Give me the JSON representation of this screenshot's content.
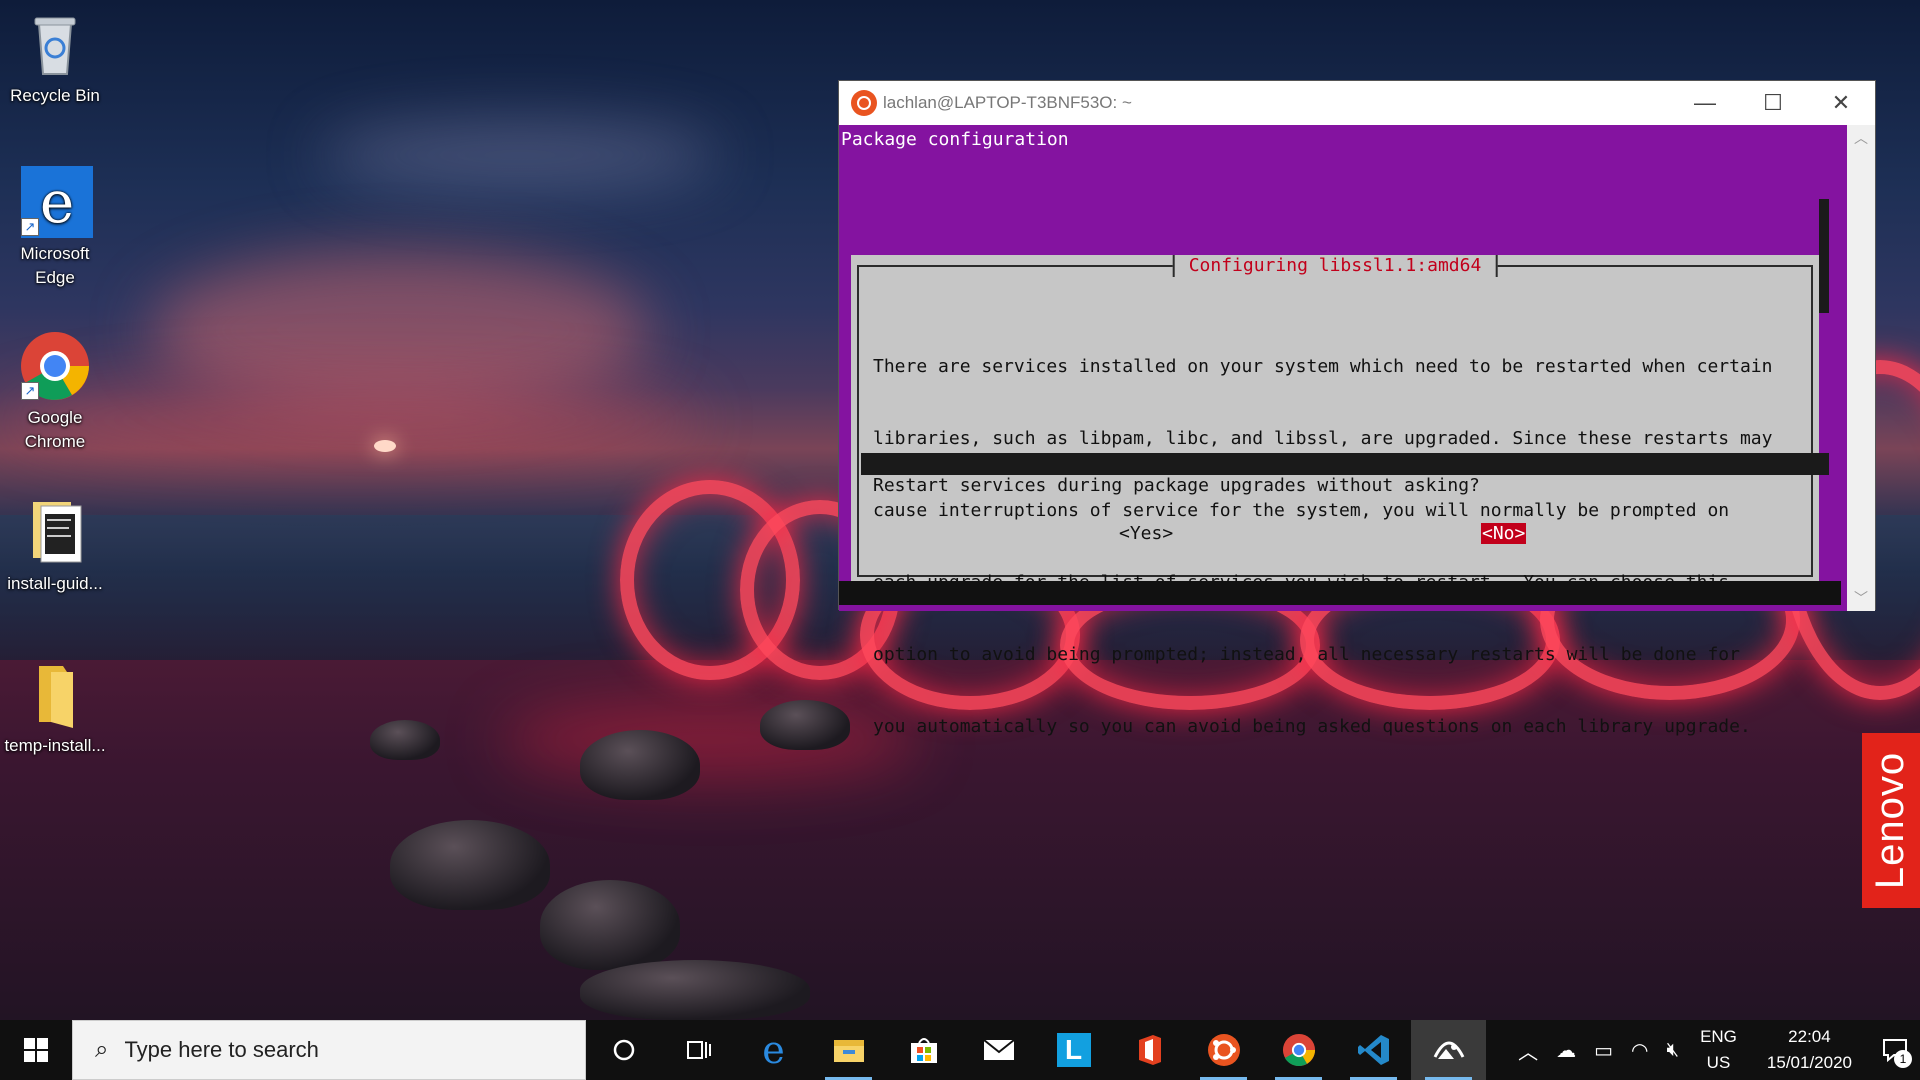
{
  "desktop": {
    "icons": [
      {
        "label": "Recycle Bin",
        "icon": "recycle-bin-icon"
      },
      {
        "label": "Microsoft Edge",
        "icon": "edge-icon"
      },
      {
        "label": "Google Chrome",
        "icon": "chrome-icon"
      },
      {
        "label": "install-guid...",
        "icon": "text-file-icon"
      },
      {
        "label": "temp-install...",
        "icon": "folder-icon"
      }
    ],
    "brand_badge": "Lenovo"
  },
  "terminal": {
    "window_title": "lachlan@LAPTOP-T3BNF53O: ~",
    "header": "Package configuration",
    "dialog": {
      "title": "Configuring libssl1.1:amd64",
      "lines": [
        "There are services installed on your system which need to be restarted when certain",
        "libraries, such as libpam, libc, and libssl, are upgraded. Since these restarts may",
        "cause interruptions of service for the system, you will normally be prompted on",
        "each upgrade for the list of services you wish to restart.  You can choose this",
        "option to avoid being prompted; instead, all necessary restarts will be done for",
        "you automatically so you can avoid being asked questions on each library upgrade."
      ],
      "question": "Restart services during package upgrades without asking?",
      "yes_label": "<Yes>",
      "no_label": "<No>",
      "selected": "<No>"
    },
    "colors": {
      "background": "#8413a0",
      "dialog": "#c6c6c6",
      "accent": "#c2001b"
    }
  },
  "taskbar": {
    "search_placeholder": "Type here to search",
    "pinned": [
      "cortana-icon",
      "task-view-icon",
      "edge-icon",
      "file-explorer-icon",
      "microsoft-store-icon",
      "mail-icon",
      "l-app-icon",
      "office-icon",
      "ubuntu-icon",
      "chrome-icon",
      "vscode-icon",
      "photos-icon"
    ],
    "language": {
      "line1": "ENG",
      "line2": "US"
    },
    "clock": {
      "time": "22:04",
      "date": "15/01/2020"
    },
    "notifications": "1"
  }
}
